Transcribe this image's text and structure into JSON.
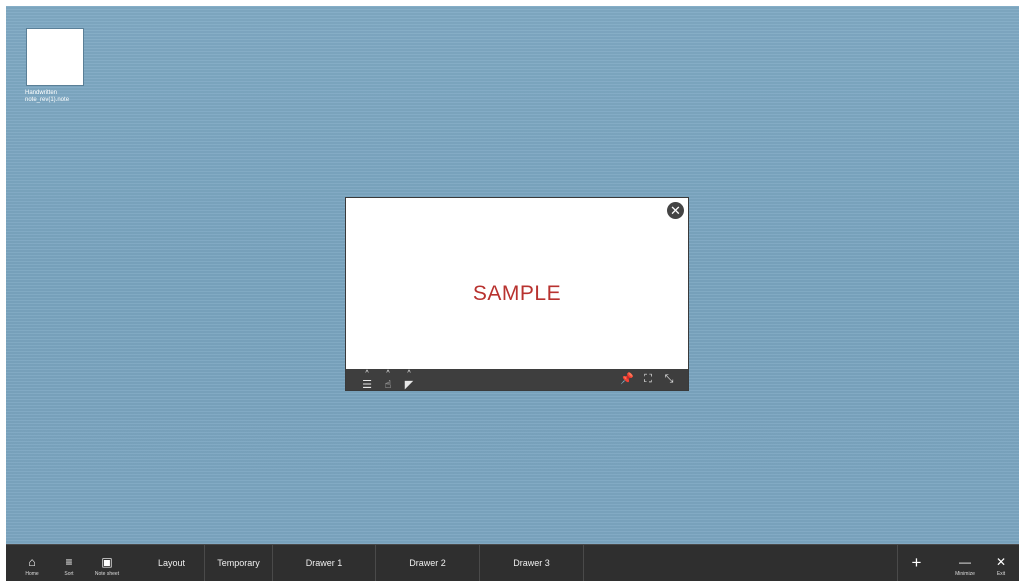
{
  "desktop": {
    "file": {
      "label": "Handwritten note_rev(1).note"
    }
  },
  "note_window": {
    "content_text": "SAMPLE",
    "close_glyph": "✕",
    "toolbar_left": [
      "☰",
      "☝",
      "◤"
    ],
    "toolbar_right": [
      "📌",
      "⛶",
      "⤡"
    ]
  },
  "taskbar": {
    "home_label": "Home",
    "sort_label": "Sort",
    "note_sheet_label": "Note sheet",
    "tabs": {
      "layout": "Layout",
      "temporary": "Temporary",
      "drawer1": "Drawer 1",
      "drawer2": "Drawer 2",
      "drawer3": "Drawer 3"
    },
    "plus_glyph": "+",
    "minimize_label": "Minimize",
    "exit_label": "Exit"
  },
  "colors": {
    "desktop_bg": "#7ea8c3",
    "taskbar_bg": "#2f2f2f",
    "sample_text": "#b8322f"
  }
}
